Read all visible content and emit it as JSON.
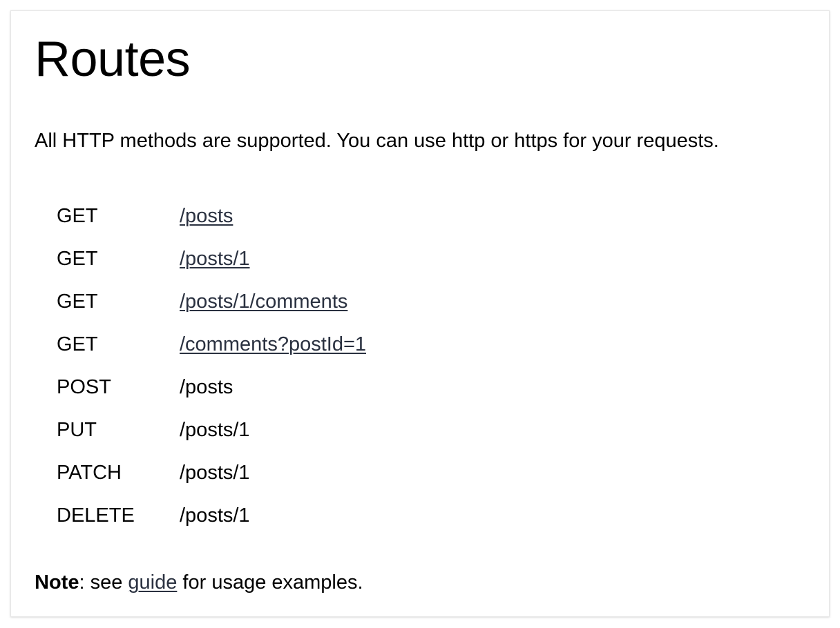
{
  "title": "Routes",
  "intro": "All HTTP methods are supported. You can use http or https for your requests.",
  "routes": [
    {
      "method": "GET",
      "path": "/posts",
      "link": true
    },
    {
      "method": "GET",
      "path": "/posts/1",
      "link": true
    },
    {
      "method": "GET",
      "path": "/posts/1/comments",
      "link": true
    },
    {
      "method": "GET",
      "path": "/comments?postId=1",
      "link": true
    },
    {
      "method": "POST",
      "path": "/posts",
      "link": false
    },
    {
      "method": "PUT",
      "path": "/posts/1",
      "link": false
    },
    {
      "method": "PATCH",
      "path": "/posts/1",
      "link": false
    },
    {
      "method": "DELETE",
      "path": "/posts/1",
      "link": false
    }
  ],
  "note": {
    "label": "Note",
    "prefix": ": see ",
    "link_text": "guide",
    "suffix": " for usage examples."
  },
  "colors": {
    "link": "#2a3140",
    "text": "#000000",
    "background": "#ffffff"
  }
}
